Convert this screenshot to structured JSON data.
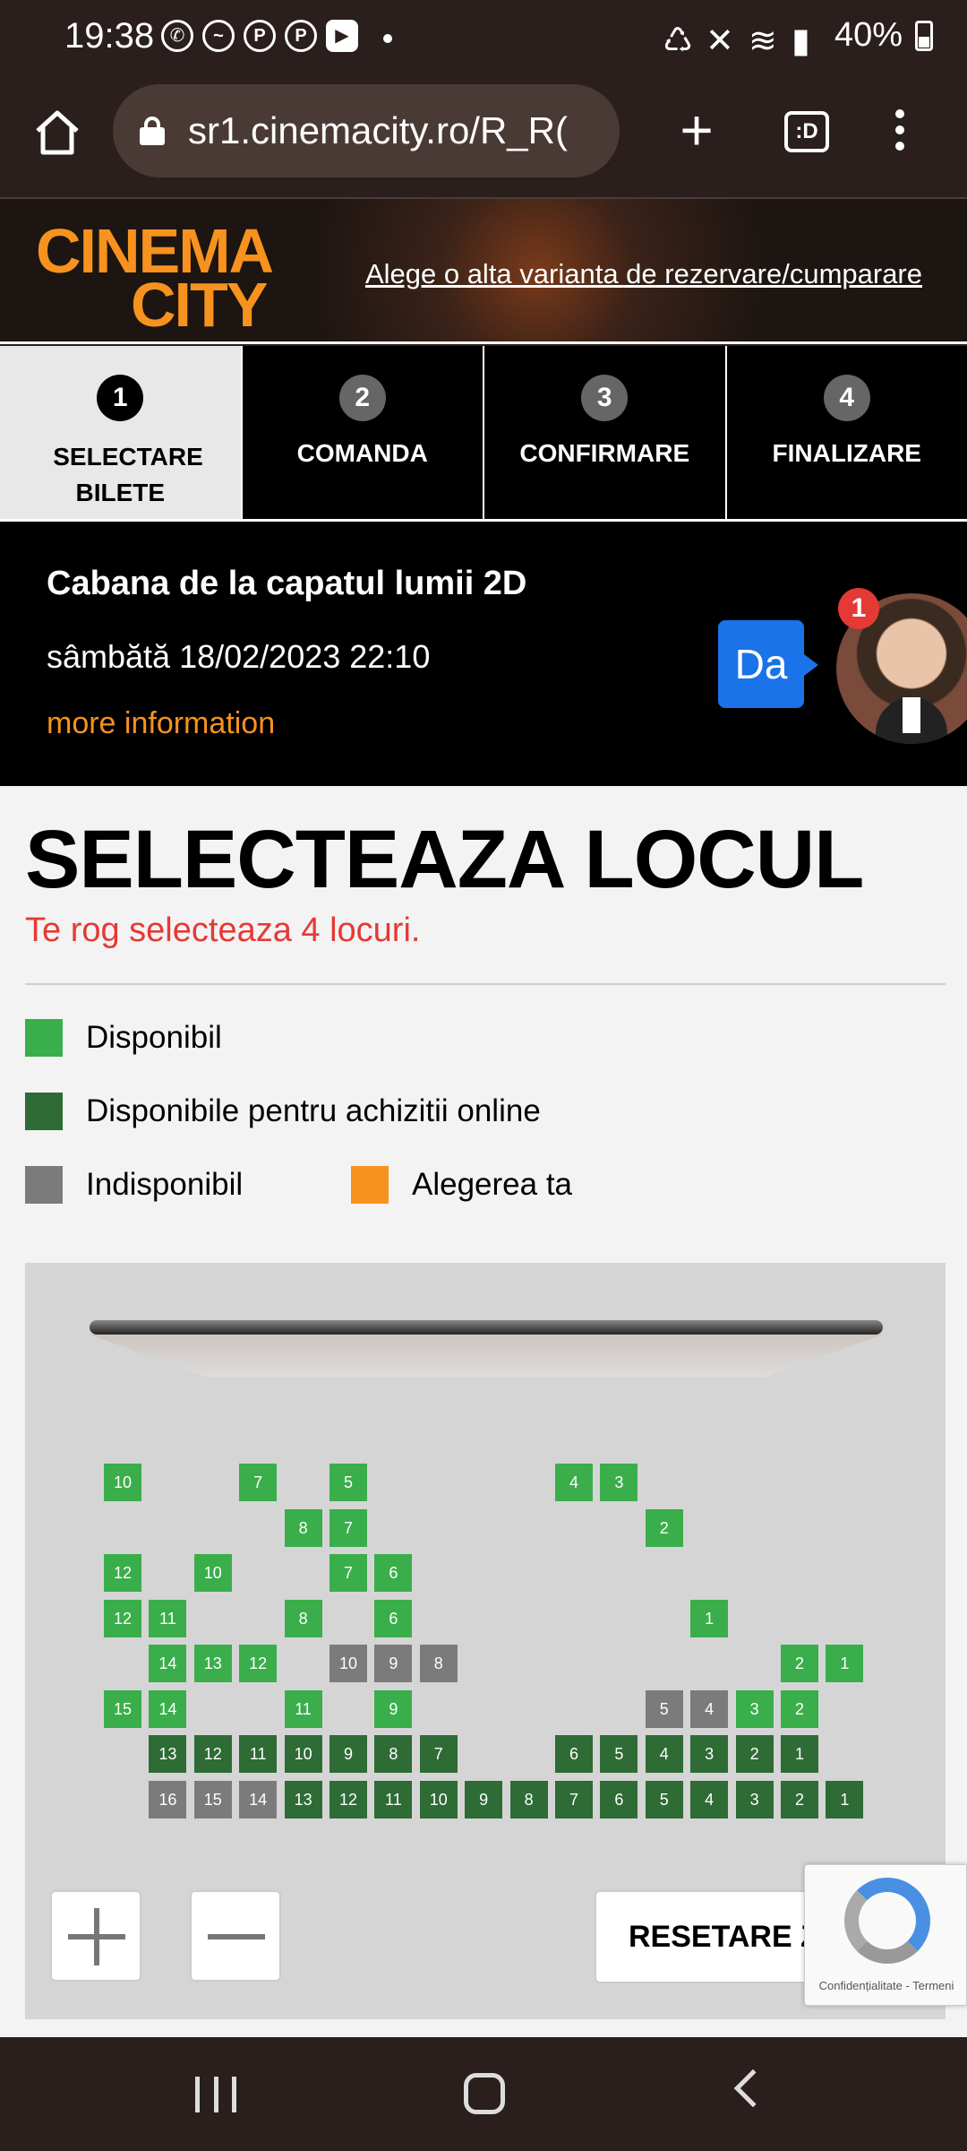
{
  "status_bar": {
    "time": "19:38",
    "battery": "40%",
    "notification_apps": [
      "whatsapp-icon",
      "messenger-icon",
      "pinterest-icon",
      "pinterest-icon",
      "youtube-icon"
    ]
  },
  "browser": {
    "url": "sr1.cinemacity.ro/R_R(",
    "tab_label": ":D"
  },
  "site": {
    "logo_line1": "CINEMA",
    "logo_line2": "CITY",
    "alt_link": "Alege o alta varianta de rezervare/cumparare",
    "accent": "#f7921e"
  },
  "steps": [
    {
      "num": "1",
      "label": "SELECTARE BILETE",
      "active": true
    },
    {
      "num": "2",
      "label": "COMANDA",
      "active": false
    },
    {
      "num": "3",
      "label": "CONFIRMARE",
      "active": false
    },
    {
      "num": "4",
      "label": "FINALIZARE",
      "active": false
    }
  ],
  "movie": {
    "title": "Cabana de la capatul lumii 2D",
    "datetime": "sâmbătă 18/02/2023 22:10",
    "more": "more information"
  },
  "chat": {
    "bubble": "Da",
    "badge": "1"
  },
  "seat_selection": {
    "heading": "SELECTEAZA LOCUL",
    "hint": "Te rog selecteaza 4 locuri.",
    "legend": [
      {
        "label": "Disponibil",
        "color": "#3aae4a"
      },
      {
        "label": "Disponibile pentru achizitii online",
        "color": "#2e6b35"
      },
      {
        "label": "Indisponibil",
        "color": "#7b7b7b"
      },
      {
        "label": "Alegerea ta",
        "color": "#f7921e"
      }
    ],
    "reset_label": "RESETARE ZOOM",
    "rows": [
      [
        {
          "n": "10",
          "s": "a",
          "c": 0
        },
        {
          "n": "7",
          "s": "a",
          "c": 3
        },
        {
          "n": "5",
          "s": "a",
          "c": 5
        },
        {
          "n": "4",
          "s": "a",
          "c": 10
        },
        {
          "n": "3",
          "s": "a",
          "c": 11
        }
      ],
      [
        {
          "n": "8",
          "s": "a",
          "c": 4
        },
        {
          "n": "7",
          "s": "a",
          "c": 5
        },
        {
          "n": "2",
          "s": "a",
          "c": 12
        }
      ],
      [
        {
          "n": "12",
          "s": "a",
          "c": 0
        },
        {
          "n": "10",
          "s": "a",
          "c": 2
        },
        {
          "n": "7",
          "s": "a",
          "c": 5
        },
        {
          "n": "6",
          "s": "a",
          "c": 6
        }
      ],
      [
        {
          "n": "12",
          "s": "a",
          "c": 0
        },
        {
          "n": "11",
          "s": "a",
          "c": 1
        },
        {
          "n": "8",
          "s": "a",
          "c": 4
        },
        {
          "n": "6",
          "s": "a",
          "c": 6
        },
        {
          "n": "1",
          "s": "a",
          "c": 13
        }
      ],
      [
        {
          "n": "14",
          "s": "a",
          "c": 1
        },
        {
          "n": "13",
          "s": "a",
          "c": 2
        },
        {
          "n": "12",
          "s": "a",
          "c": 3
        },
        {
          "n": "10",
          "s": "u",
          "c": 5
        },
        {
          "n": "9",
          "s": "u",
          "c": 6
        },
        {
          "n": "8",
          "s": "u",
          "c": 7
        },
        {
          "n": "2",
          "s": "a",
          "c": 15
        },
        {
          "n": "1",
          "s": "a",
          "c": 16
        }
      ],
      [
        {
          "n": "15",
          "s": "a",
          "c": 0
        },
        {
          "n": "14",
          "s": "a",
          "c": 1
        },
        {
          "n": "11",
          "s": "a",
          "c": 4
        },
        {
          "n": "9",
          "s": "a",
          "c": 6
        },
        {
          "n": "5",
          "s": "u",
          "c": 12
        },
        {
          "n": "4",
          "s": "u",
          "c": 13
        },
        {
          "n": "3",
          "s": "a",
          "c": 14
        },
        {
          "n": "2",
          "s": "a",
          "c": 15
        }
      ],
      [
        {
          "n": "13",
          "s": "o",
          "c": 1
        },
        {
          "n": "12",
          "s": "o",
          "c": 2
        },
        {
          "n": "11",
          "s": "o",
          "c": 3
        },
        {
          "n": "10",
          "s": "o",
          "c": 4
        },
        {
          "n": "9",
          "s": "o",
          "c": 5
        },
        {
          "n": "8",
          "s": "o",
          "c": 6
        },
        {
          "n": "7",
          "s": "o",
          "c": 7
        },
        {
          "n": "6",
          "s": "o",
          "c": 10
        },
        {
          "n": "5",
          "s": "o",
          "c": 11
        },
        {
          "n": "4",
          "s": "o",
          "c": 12
        },
        {
          "n": "3",
          "s": "o",
          "c": 13
        },
        {
          "n": "2",
          "s": "o",
          "c": 14
        },
        {
          "n": "1",
          "s": "o",
          "c": 15
        }
      ],
      [
        {
          "n": "16",
          "s": "u",
          "c": 1
        },
        {
          "n": "15",
          "s": "u",
          "c": 2
        },
        {
          "n": "14",
          "s": "u",
          "c": 3
        },
        {
          "n": "13",
          "s": "o",
          "c": 4
        },
        {
          "n": "12",
          "s": "o",
          "c": 5
        },
        {
          "n": "11",
          "s": "o",
          "c": 6
        },
        {
          "n": "10",
          "s": "o",
          "c": 7
        },
        {
          "n": "9",
          "s": "o",
          "c": 8
        },
        {
          "n": "8",
          "s": "o",
          "c": 9
        },
        {
          "n": "7",
          "s": "o",
          "c": 10
        },
        {
          "n": "6",
          "s": "o",
          "c": 11
        },
        {
          "n": "5",
          "s": "o",
          "c": 12
        },
        {
          "n": "4",
          "s": "o",
          "c": 13
        },
        {
          "n": "3",
          "s": "o",
          "c": 14
        },
        {
          "n": "2",
          "s": "o",
          "c": 15
        },
        {
          "n": "1",
          "s": "o",
          "c": 16
        }
      ]
    ]
  },
  "recaptcha": {
    "footer": "Confidențialitate - Termeni"
  }
}
